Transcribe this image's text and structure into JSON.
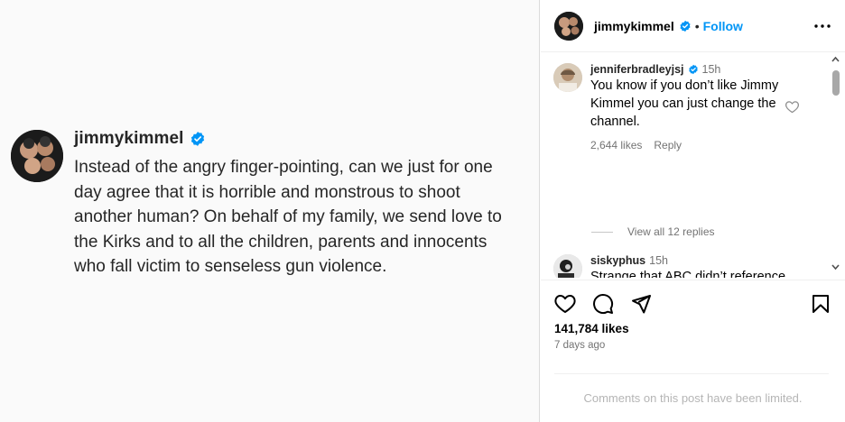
{
  "post": {
    "username": "jimmykimmel",
    "text": "Instead of the angry finger-pointing, can we just for one day agree that it is horrible and monstrous to shoot another human? On behalf of my family, we send love to the Kirks and to all the children, parents and innocents who fall victim to senseless gun violence."
  },
  "header": {
    "username": "jimmykimmel",
    "separator": "•",
    "follow_label": "Follow"
  },
  "comments": [
    {
      "username": "jenniferbradleyjsj",
      "time": "15h",
      "verified": true,
      "text": "You know if you don’t like Jimmy Kimmel you can just change the channel.",
      "likes": "2,644 likes",
      "reply_label": "Reply",
      "view_replies": "View all 12 replies"
    },
    {
      "username": "siskyphus",
      "time": "15h",
      "verified": false,
      "text": "Strange that ABC didn’t reference this post in their decision-making process 🤔"
    }
  ],
  "actions": {
    "likes": "141,784 likes",
    "posted": "7 days ago"
  },
  "footer": {
    "limited": "Comments on this post have been limited."
  },
  "colors": {
    "accent": "#0095f6",
    "muted": "#737373",
    "verified": "#0095f6"
  },
  "icons": [
    "verified-icon",
    "more-icon",
    "heart-icon",
    "comment-icon",
    "share-icon",
    "bookmark-icon"
  ]
}
